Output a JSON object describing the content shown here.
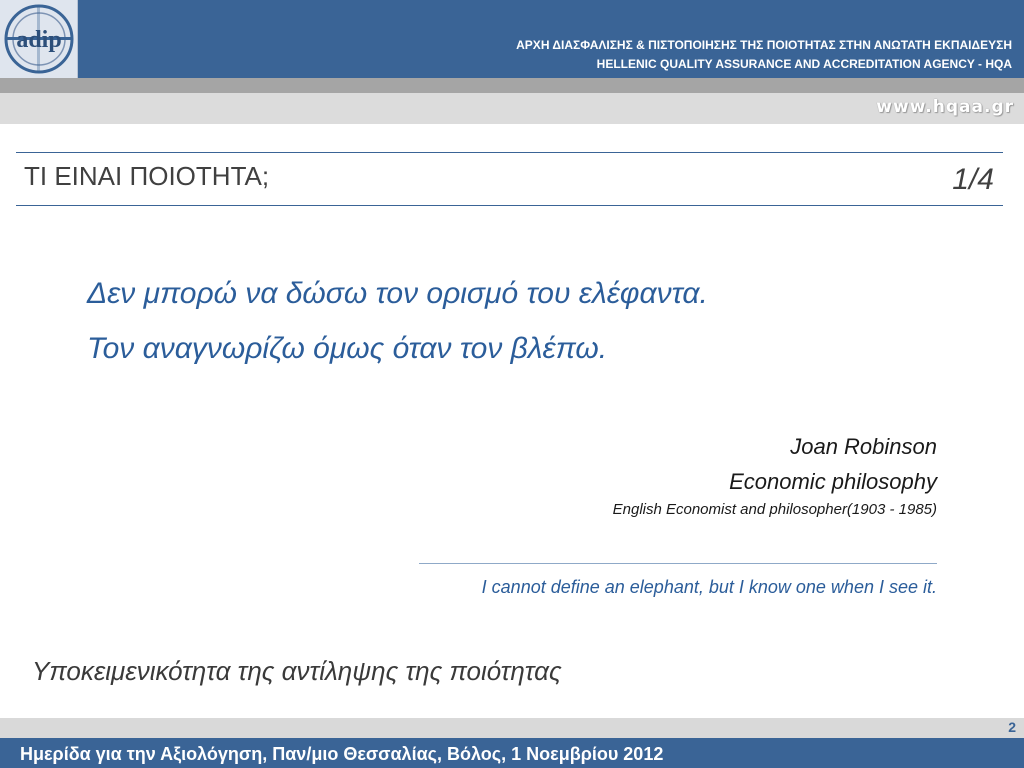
{
  "header": {
    "logo_text": "adip",
    "org_greek": "ΑΡΧΗ ΔΙΑΣΦΑΛΙΣΗΣ & ΠΙΣΤΟΠΟΙΗΣΗΣ ΤΗΣ ΠΟΙΟΤΗΤΑΣ ΣΤΗΝ ΑΝΩΤΑΤΗ ΕΚΠΑΙΔΕΥΣΗ",
    "org_english": "HELLENIC QUALITY ASSURANCE AND ACCREDITATION AGENCY - HQA",
    "website": "www.hqaa.gr"
  },
  "title_section": {
    "title": "ΤΙ ΕΙΝΑΙ ΠΟΙΟΤΗΤΑ;",
    "pagination": "1/4"
  },
  "body": {
    "quote_greek_line1": "Δεν μπορώ να δώσω τον ορισμό του ελέφαντα.",
    "quote_greek_line2": "Τον αναγνωρίζω όμως όταν τον βλέπω.",
    "author": "Joan Robinson",
    "work": "Economic philosophy",
    "author_description": "English Economist and philosopher(1903 - 1985)",
    "quote_english": "I cannot define an elephant, but I know one when I see it.",
    "note": "Υποκειμενικότητα της αντίληψης της ποιότητας"
  },
  "footer": {
    "page_number": "2",
    "event": "Ημερίδα για την Αξιολόγηση, Παν/μιο Θεσσαλίας, Βόλος, 1 Νοεμβρίου 2012"
  },
  "colors": {
    "brand_blue": "#3a6496",
    "quote_blue": "#2b5d9a",
    "band_gray": "#a5a5a5",
    "light_gray": "#dcdcdc"
  },
  "icons": {
    "logo": "adip-logo-icon"
  }
}
